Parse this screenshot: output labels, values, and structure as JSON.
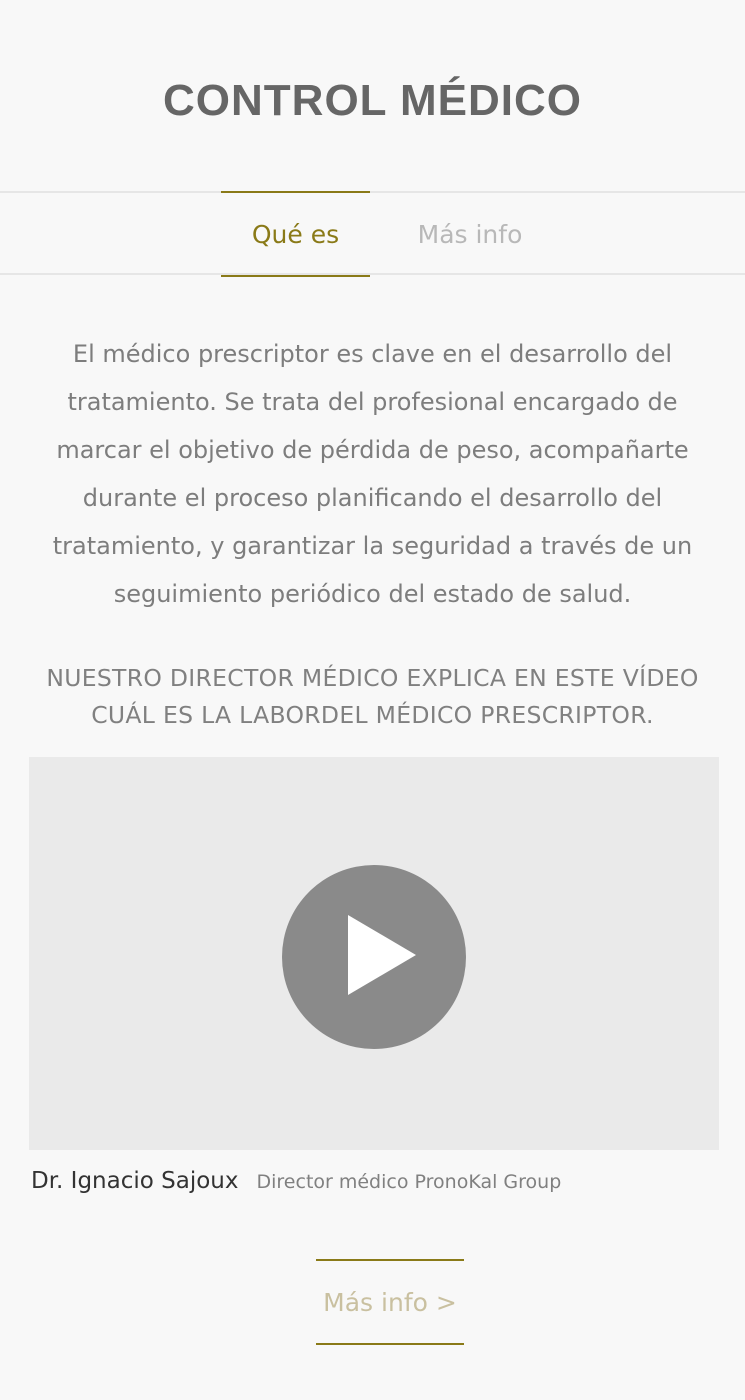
{
  "header": {
    "title": "CONTROL MÉDICO"
  },
  "tabs": [
    {
      "label": "Qué es",
      "active": true
    },
    {
      "label": "Más info",
      "active": false
    }
  ],
  "content": {
    "description": "El médico prescriptor es clave en el desarrollo del tratamiento. Se trata del profesional encargado de marcar el objetivo de pérdida de peso, acompañarte durante el proceso planificando el desarrollo del tratamiento, y garantizar la seguridad a través de un seguimiento periódico del estado de salud.",
    "video_heading": "NUESTRO DIRECTOR MÉDICO EXPLICA EN ESTE VÍDEO CUÁL ES LA LABORDEL MÉDICO PRESCRIPTOR."
  },
  "video": {
    "play_icon": "play-icon",
    "caption_name": "Dr. Ignacio Sajoux",
    "caption_role": "Director médico PronoKal Group"
  },
  "cta": {
    "label": "Más info >"
  },
  "colors": {
    "accent": "#8a7a18",
    "cta_text": "#c9c0a0",
    "background": "#f8f8f8",
    "video_bg": "#eaeaea",
    "play_circle": "#8a8a8a"
  }
}
